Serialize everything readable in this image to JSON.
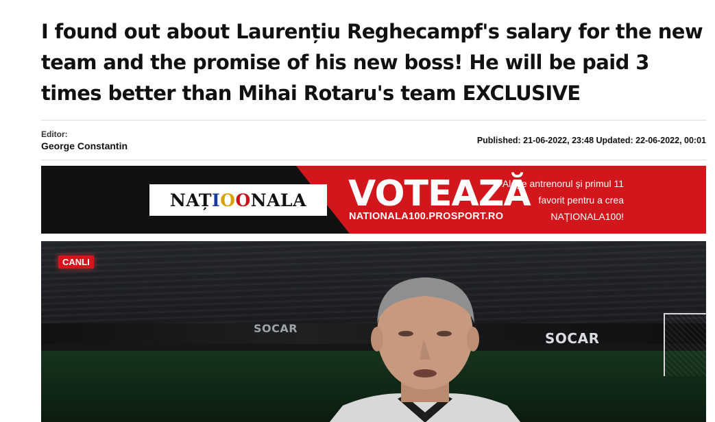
{
  "article": {
    "headline": "I found out about Laurențiu Reghecampf's salary for the new team and the promise of his new boss! He will be paid 3 times better than Mihai Rotaru's team EXCLUSIVE",
    "editor_label": "Editor:",
    "editor_name": "George Constantin",
    "dates": "Published: 21-06-2022, 23:48 Updated: 22-06-2022, 00:01"
  },
  "banner": {
    "logo_parts": [
      "NAȚ",
      "I",
      "O",
      "O",
      "NALA"
    ],
    "vote_text": "VOTEAZĂ",
    "url_text": "NATIONALA100.PROSPORT.RO",
    "cta_lines": [
      "Alege antrenorul și primul 11",
      "favorit pentru a crea",
      "NAȚIONALA100!"
    ]
  },
  "video": {
    "channel_badge": "CANLI",
    "sponsor_1": "SOCAR",
    "sponsor_2": "SOCAR"
  },
  "colors": {
    "banner_red": "#d1161c",
    "banner_black": "#111111",
    "badge_red": "#d5141b"
  }
}
